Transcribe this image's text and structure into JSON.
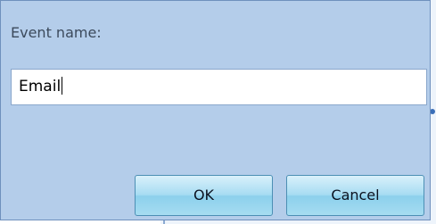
{
  "dialog": {
    "label": "Event name:",
    "input_value": "Email",
    "ok_label": "OK",
    "cancel_label": "Cancel"
  }
}
